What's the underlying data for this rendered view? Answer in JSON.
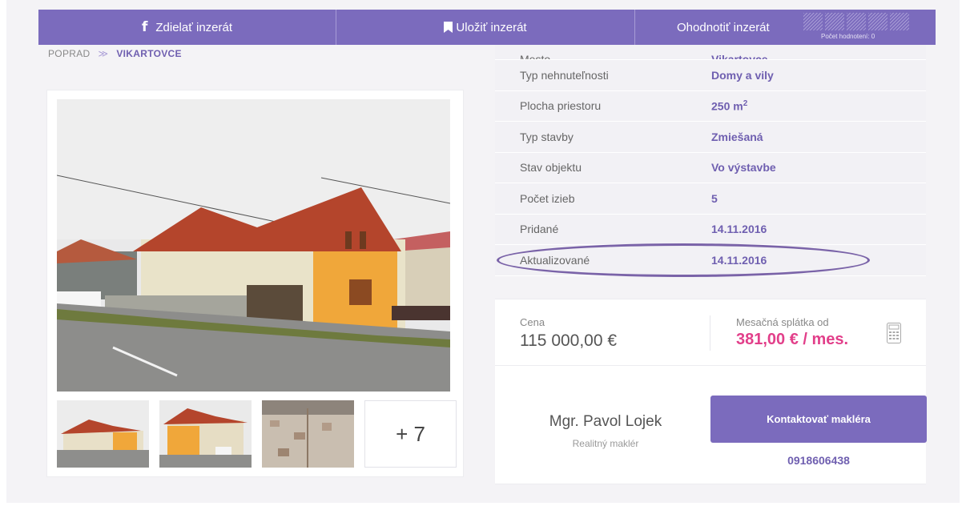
{
  "actions": {
    "share_label": "Zdielať inzerát",
    "save_label": "Uložiť inzerát",
    "rate_label": "Ohodnotiť inzerát",
    "rating_count": "Počet hodnotení: 0"
  },
  "breadcrumb": {
    "items": [
      "POPRAD",
      "VIKARTOVCE"
    ],
    "separator": "≫"
  },
  "gallery": {
    "more_label": "+ 7"
  },
  "details": {
    "rows": [
      {
        "label": "Mesto",
        "value": "Vikartovce"
      },
      {
        "label": "Typ nehnuteľnosti",
        "value": "Domy a vily"
      },
      {
        "label": "Plocha priestoru",
        "value": "250 m"
      },
      {
        "label": "Typ stavby",
        "value": "Zmiešaná"
      },
      {
        "label": "Stav objektu",
        "value": "Vo výstavbe"
      },
      {
        "label": "Počet izieb",
        "value": "5"
      },
      {
        "label": "Pridané",
        "value": "14.11.2016"
      },
      {
        "label": "Aktualizované",
        "value": "14.11.2016"
      }
    ],
    "area_superscript": "2"
  },
  "price": {
    "label": "Cena",
    "value": "115 000,00 €",
    "installment_label": "Mesačná splátka od",
    "installment_value": "381,00 € / mes."
  },
  "agent": {
    "name": "Mgr. Pavol Lojek",
    "role": "Realitný maklér",
    "contact_label": "Kontaktovať makléra",
    "phone": "0918606438"
  },
  "colors": {
    "accent": "#7b6bbd",
    "price_highlight": "#e23f8a",
    "annotation_ellipse": "#7a63a8"
  }
}
